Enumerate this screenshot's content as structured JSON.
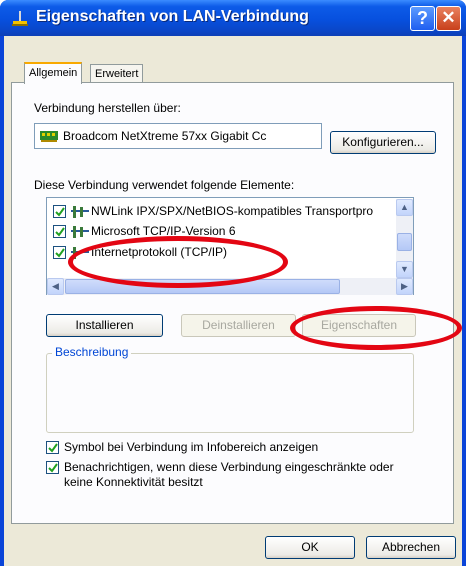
{
  "window": {
    "title": "Eigenschaften von LAN-Verbindung",
    "help_glyph": "?",
    "close_glyph": "✕"
  },
  "tabs": [
    {
      "label": "Allgemein",
      "active": true
    },
    {
      "label": "Erweitert",
      "active": false
    }
  ],
  "connect_via": {
    "label": "Verbindung herstellen über:",
    "adapter": "Broadcom NetXtreme 57xx Gigabit Cc",
    "configure_button": "Konfigurieren..."
  },
  "components": {
    "label": "Diese Verbindung verwendet folgende Elemente:",
    "items": [
      {
        "label": "NWLink IPX/SPX/NetBIOS-kompatibles Transportpro",
        "checked": true
      },
      {
        "label": "Microsoft TCP/IP-Version 6",
        "checked": true
      },
      {
        "label": "Internetprotokoll (TCP/IP)",
        "checked": true
      }
    ]
  },
  "actions": {
    "install": "Installieren",
    "uninstall": "Deinstallieren",
    "properties": "Eigenschaften"
  },
  "description": {
    "title": "Beschreibung",
    "text": ""
  },
  "options": {
    "show_icon": {
      "label": "Symbol bei Verbindung im Infobereich anzeigen",
      "checked": true
    },
    "notify": {
      "label_line1": "Benachrichtigen, wenn diese Verbindung eingeschränkte oder",
      "label_line2": "keine Konnektivität besitzt",
      "checked": true
    }
  },
  "footer": {
    "ok": "OK",
    "cancel": "Abbrechen"
  },
  "colors": {
    "titlebar": "#0750de",
    "highlight_ellipse": "#e30613",
    "group_title": "#0046d5"
  }
}
